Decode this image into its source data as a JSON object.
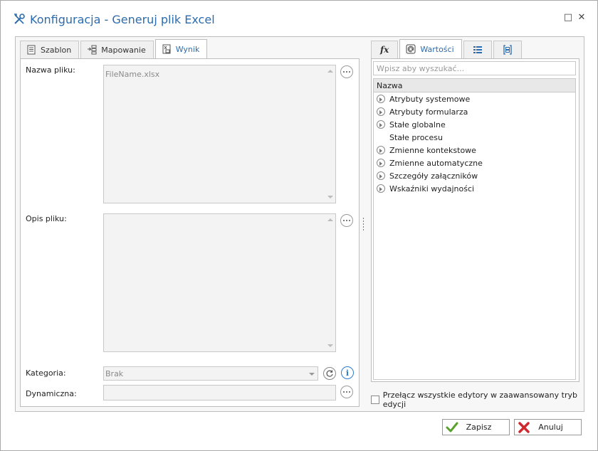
{
  "window": {
    "title": "Konfiguracja - Generuj plik Excel",
    "maximize_glyph": "□",
    "close_glyph": "✕"
  },
  "left_tabs": [
    {
      "label": "Szablon",
      "icon": "document-icon",
      "active": false
    },
    {
      "label": "Mapowanie",
      "icon": "mapping-icon",
      "active": false
    },
    {
      "label": "Wynik",
      "icon": "excel-result-icon",
      "active": true
    }
  ],
  "form": {
    "file_name_label": "Nazwa pliku:",
    "file_name_value": "FileName.xlsx",
    "file_desc_label": "Opis pliku:",
    "file_desc_value": "",
    "category_label": "Kategoria:",
    "category_value": "Brak",
    "dynamic_label": "Dynamiczna:",
    "dynamic_value": ""
  },
  "right_tabs": [
    {
      "label": "",
      "icon": "function-fx-icon",
      "active": false
    },
    {
      "label": "Wartości",
      "icon": "values-at-icon",
      "active": true
    },
    {
      "label": "",
      "icon": "list-icon",
      "active": false
    },
    {
      "label": "",
      "icon": "bracket-box-icon",
      "active": false
    }
  ],
  "values_panel": {
    "search_placeholder": "Wpisz aby wyszukać...",
    "column_header": "Nazwa",
    "items": [
      {
        "label": "Atrybuty systemowe",
        "expandable": true
      },
      {
        "label": "Atrybuty formularza",
        "expandable": true
      },
      {
        "label": "Stałe globalne",
        "expandable": true
      },
      {
        "label": "Stałe procesu",
        "expandable": false
      },
      {
        "label": "Zmienne kontekstowe",
        "expandable": true
      },
      {
        "label": "Zmienne automatyczne",
        "expandable": true
      },
      {
        "label": "Szczegóły załączników",
        "expandable": true
      },
      {
        "label": "Wskaźniki wydajności",
        "expandable": true
      }
    ],
    "advanced_toggle_label": "Przełącz wszystkie edytory w zaawansowany tryb edycji"
  },
  "buttons": {
    "save_label": "Zapisz",
    "cancel_label": "Anuluj"
  },
  "colors": {
    "accent": "#2b6cb0",
    "save_check": "#5aa02c",
    "cancel_x": "#d0282e"
  }
}
